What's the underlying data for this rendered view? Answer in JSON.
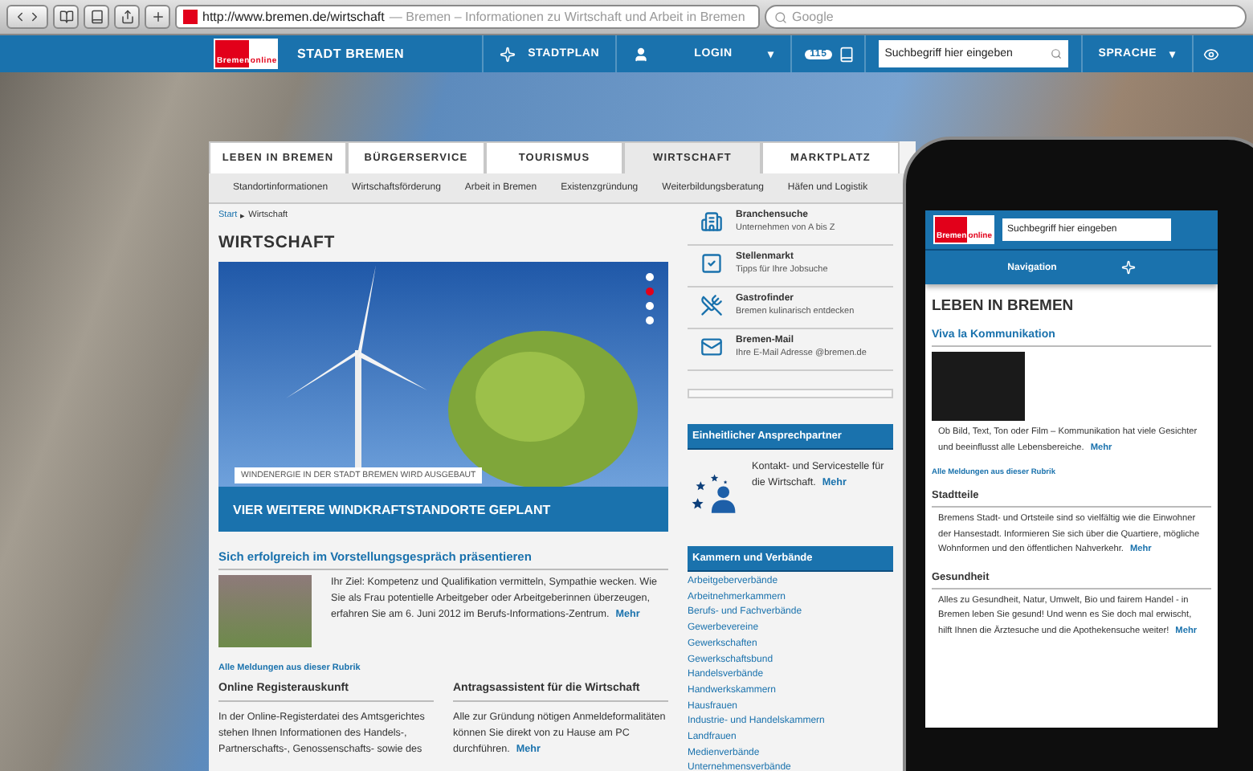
{
  "browser": {
    "url": "http://www.bremen.de/wirtschaft",
    "page_title": "— Bremen – Informationen zu Wirtschaft und Arbeit in Bremen",
    "search_placeholder": "Google"
  },
  "header": {
    "logo": [
      "Bremen",
      "online"
    ],
    "site_name": "STADT BREMEN",
    "stadtplan": "STADTPLAN",
    "login": "LOGIN",
    "login_caret": "▾",
    "service_number": "115",
    "search_placeholder": "Suchbegriff hier eingeben",
    "language": "SPRACHE",
    "language_caret": "▾"
  },
  "tabs": [
    {
      "label": "LEBEN IN BREMEN",
      "selected": false
    },
    {
      "label": "BÜRGERSERVICE",
      "selected": false
    },
    {
      "label": "TOURISMUS",
      "selected": false
    },
    {
      "label": "WIRTSCHAFT",
      "selected": true
    },
    {
      "label": "MARKTPLATZ",
      "selected": false
    }
  ],
  "subnav": [
    "Standortinformationen",
    "Wirtschaftsförderung",
    "Arbeit in Bremen",
    "Existenzgründung",
    "Weiterbildungsberatung",
    "Häfen und Logistik"
  ],
  "breadcrumb": {
    "items": [
      "Start",
      "Wirtschaft"
    ],
    "separator": "▸"
  },
  "page_title": "WIRTSCHAFT",
  "hero": {
    "caption": "WINDENERGIE IN DER STADT BREMEN WIRD AUSGEBAUT",
    "headline": "VIER WEITERE WINDKRAFTSTANDORTE GEPLANT",
    "slides": [
      {
        "selected": false
      },
      {
        "selected": true
      },
      {
        "selected": false
      },
      {
        "selected": false
      }
    ]
  },
  "article": {
    "title": "Sich erfolgreich im Vorstellungsgespräch präsentieren",
    "text": "Ihr Ziel: Kompetenz und Qualifikation vermitteln, Sympathie wecken. Wie Sie als Frau potentielle Arbeitgeber oder Arbeitgeberinnen überzeugen, erfahren Sie am 6. Juni 2012 im Berufs-Informations-Zentrum.",
    "more": "Mehr"
  },
  "all_news": "Alle Meldungen aus dieser Rubrik",
  "teasers": [
    {
      "title": "Online Registerauskunft",
      "text": "In der Online-Registerdatei des Amtsgerichtes stehen Ihnen Informationen des Handels-, Partnerschafts-, Genossenschafts- sowie des"
    },
    {
      "title": "Antragsassistent für die Wirtschaft",
      "text": "Alle zur Gründung nötigen Anmeldeformalitäten können Sie direkt von zu Hause am PC durchführen.",
      "more": "Mehr"
    }
  ],
  "services": [
    {
      "kind": "buildings",
      "title": "Branchensuche",
      "subtitle": "Unternehmen von A bis Z"
    },
    {
      "kind": "check",
      "title": "Stellenmarkt",
      "subtitle": "Tipps für Ihre Jobsuche"
    },
    {
      "kind": "cutlery",
      "title": "Gastrofinder",
      "subtitle": "Bremen kulinarisch entdecken"
    },
    {
      "kind": "mail",
      "title": "Bremen-Mail",
      "subtitle": "Ihre E-Mail Adresse @bremen.de"
    }
  ],
  "contact": {
    "title": "Einheitlicher Ansprechpartner",
    "text": "Kontakt- und Servicestelle für die Wirtschaft.",
    "more": "Mehr"
  },
  "chambers": {
    "title": "Kammern und Verbände",
    "links": [
      "Arbeitgeberverbände",
      "Arbeitnehmerkammern",
      "Berufs- und Fachverbände",
      "Gewerbevereine",
      "Gewerkschaften",
      "Gewerkschaftsbund",
      "Handelsverbände",
      "Handwerkskammern",
      "Hausfrauen",
      "Industrie- und Handelskammern",
      "Landfrauen",
      "Medienverbände",
      "Unternehmensverbände"
    ]
  },
  "phone": {
    "logo": [
      "Bremen",
      "online"
    ],
    "search_placeholder": "Suchbegriff hier eingeben",
    "navigation": "Navigation",
    "title": "LEBEN IN BREMEN",
    "feature": {
      "title": "Viva la Kommunikation",
      "text": "Ob Bild, Text, Ton oder Film – Kommunikation hat viele Gesichter und beeinflusst alle Lebensbereiche.",
      "more": "Mehr"
    },
    "all_news": "Alle Meldungen aus dieser Rubrik",
    "sections": [
      {
        "title": "Stadtteile",
        "text": "Bremens Stadt- und Ortsteile sind so vielfältig wie die Einwohner der Hansestadt. Informieren Sie sich über die Quartiere, mögliche Wohnformen und den öffentlichen Nahverkehr.",
        "more": "Mehr"
      },
      {
        "title": "Gesundheit",
        "text": "Alles zu Gesundheit, Natur, Umwelt, Bio und fairem Handel - in Bremen leben Sie gesund! Und wenn es Sie doch mal erwischt, hilft Ihnen die Ärztesuche und die Apothekensuche weiter!",
        "more": "Mehr"
      }
    ]
  }
}
